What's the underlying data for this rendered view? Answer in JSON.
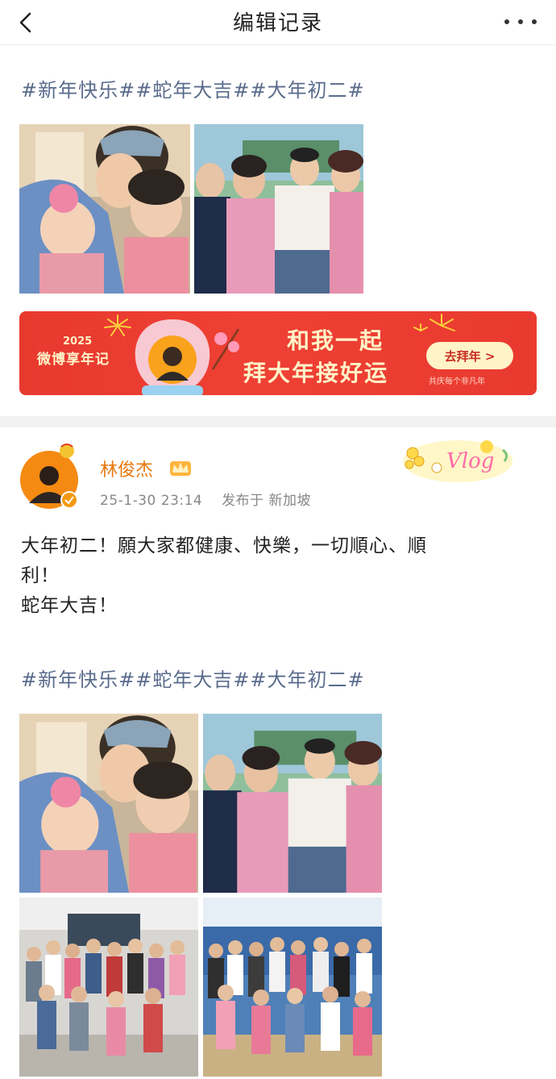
{
  "header": {
    "title": "编辑记录",
    "back_icon": "chevron-left-icon",
    "more_icon": "more-dots-icon"
  },
  "top_post": {
    "hashtags": "#新年快乐##蛇年大吉##大年初二#"
  },
  "banner": {
    "year": "2025",
    "brand": "微博享年记",
    "line1": "和我一起",
    "line2": "拜大年接好运",
    "button": "去拜年 >",
    "subtext": "共庆每个非凡年"
  },
  "post": {
    "username": "林俊杰",
    "timestamp": "25-1-30 23:14",
    "location_label": "发布于 新加坡",
    "text_line1": "大年初二！願大家都健康、快樂，一切順心、順",
    "text_line2": "利！",
    "text_line3": "蛇年大吉！",
    "hashtags": "#新年快乐##蛇年大吉##大年初二#",
    "badge_text": "Vlog"
  },
  "colors": {
    "accent_orange": "#e8780f",
    "hashtag_blue": "#5a6b8c",
    "banner_red": "#e93a30",
    "banner_cream": "#fff3c8"
  }
}
